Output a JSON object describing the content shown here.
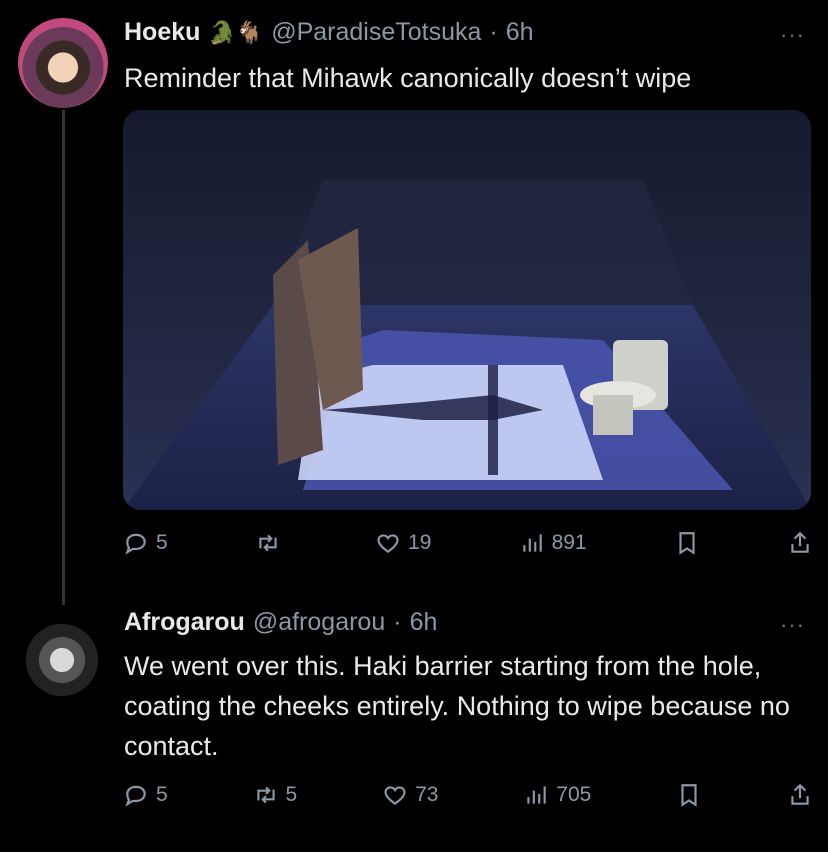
{
  "tweets": [
    {
      "name": "Hoeku",
      "emoji": "🐊🐐",
      "handle": "@ParadiseTotsuka",
      "time": "6h",
      "text": "Reminder that Mihawk canonically doesn’t wipe",
      "has_media": true,
      "stats": {
        "replies": "5",
        "reposts": "",
        "likes": "19",
        "views": "891"
      }
    },
    {
      "name": "Afrogarou",
      "handle": "@afrogarou",
      "time": "6h",
      "text": "We went over this. Haki barrier starting from the hole, coating the cheeks entirely. Nothing to wipe because no contact.",
      "stats": {
        "replies": "5",
        "reposts": "5",
        "likes": "73",
        "views": "705"
      }
    }
  ],
  "icons": {
    "reply": "reply-icon",
    "repost": "repost-icon",
    "like": "heart-icon",
    "views": "views-icon",
    "bookmark": "bookmark-icon",
    "share": "share-icon",
    "more": "more-icon"
  },
  "colors": {
    "background": "#000000",
    "text": "#e7e9ea",
    "muted": "#8b98a5"
  },
  "ui": {
    "separator": "·",
    "more": "···"
  }
}
